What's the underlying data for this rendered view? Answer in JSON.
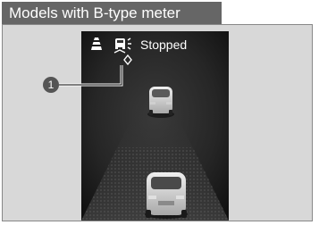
{
  "header": {
    "title": "Models with B-type meter"
  },
  "meter": {
    "status_text": "Stopped",
    "icons": [
      "road-lanes-icon",
      "lead-car-icon",
      "callout-diamond-icon"
    ]
  },
  "callout": {
    "number": "1"
  },
  "colors": {
    "header_bg": "#666666",
    "frame_bg": "#d8d8d8",
    "display_bg": "#2a2a2a",
    "callout_bg": "#555555"
  }
}
